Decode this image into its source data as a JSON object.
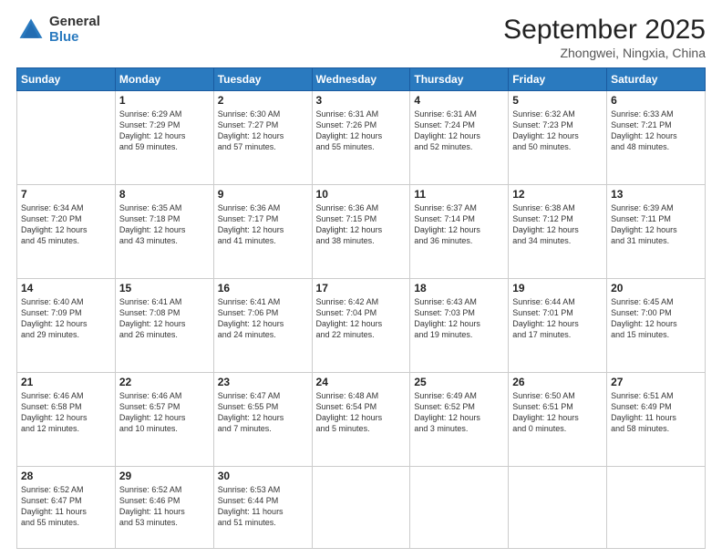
{
  "logo": {
    "general": "General",
    "blue": "Blue"
  },
  "title": {
    "month": "September 2025",
    "location": "Zhongwei, Ningxia, China"
  },
  "weekdays": [
    "Sunday",
    "Monday",
    "Tuesday",
    "Wednesday",
    "Thursday",
    "Friday",
    "Saturday"
  ],
  "weeks": [
    [
      {
        "day": "",
        "info": ""
      },
      {
        "day": "1",
        "info": "Sunrise: 6:29 AM\nSunset: 7:29 PM\nDaylight: 12 hours\nand 59 minutes."
      },
      {
        "day": "2",
        "info": "Sunrise: 6:30 AM\nSunset: 7:27 PM\nDaylight: 12 hours\nand 57 minutes."
      },
      {
        "day": "3",
        "info": "Sunrise: 6:31 AM\nSunset: 7:26 PM\nDaylight: 12 hours\nand 55 minutes."
      },
      {
        "day": "4",
        "info": "Sunrise: 6:31 AM\nSunset: 7:24 PM\nDaylight: 12 hours\nand 52 minutes."
      },
      {
        "day": "5",
        "info": "Sunrise: 6:32 AM\nSunset: 7:23 PM\nDaylight: 12 hours\nand 50 minutes."
      },
      {
        "day": "6",
        "info": "Sunrise: 6:33 AM\nSunset: 7:21 PM\nDaylight: 12 hours\nand 48 minutes."
      }
    ],
    [
      {
        "day": "7",
        "info": "Sunrise: 6:34 AM\nSunset: 7:20 PM\nDaylight: 12 hours\nand 45 minutes."
      },
      {
        "day": "8",
        "info": "Sunrise: 6:35 AM\nSunset: 7:18 PM\nDaylight: 12 hours\nand 43 minutes."
      },
      {
        "day": "9",
        "info": "Sunrise: 6:36 AM\nSunset: 7:17 PM\nDaylight: 12 hours\nand 41 minutes."
      },
      {
        "day": "10",
        "info": "Sunrise: 6:36 AM\nSunset: 7:15 PM\nDaylight: 12 hours\nand 38 minutes."
      },
      {
        "day": "11",
        "info": "Sunrise: 6:37 AM\nSunset: 7:14 PM\nDaylight: 12 hours\nand 36 minutes."
      },
      {
        "day": "12",
        "info": "Sunrise: 6:38 AM\nSunset: 7:12 PM\nDaylight: 12 hours\nand 34 minutes."
      },
      {
        "day": "13",
        "info": "Sunrise: 6:39 AM\nSunset: 7:11 PM\nDaylight: 12 hours\nand 31 minutes."
      }
    ],
    [
      {
        "day": "14",
        "info": "Sunrise: 6:40 AM\nSunset: 7:09 PM\nDaylight: 12 hours\nand 29 minutes."
      },
      {
        "day": "15",
        "info": "Sunrise: 6:41 AM\nSunset: 7:08 PM\nDaylight: 12 hours\nand 26 minutes."
      },
      {
        "day": "16",
        "info": "Sunrise: 6:41 AM\nSunset: 7:06 PM\nDaylight: 12 hours\nand 24 minutes."
      },
      {
        "day": "17",
        "info": "Sunrise: 6:42 AM\nSunset: 7:04 PM\nDaylight: 12 hours\nand 22 minutes."
      },
      {
        "day": "18",
        "info": "Sunrise: 6:43 AM\nSunset: 7:03 PM\nDaylight: 12 hours\nand 19 minutes."
      },
      {
        "day": "19",
        "info": "Sunrise: 6:44 AM\nSunset: 7:01 PM\nDaylight: 12 hours\nand 17 minutes."
      },
      {
        "day": "20",
        "info": "Sunrise: 6:45 AM\nSunset: 7:00 PM\nDaylight: 12 hours\nand 15 minutes."
      }
    ],
    [
      {
        "day": "21",
        "info": "Sunrise: 6:46 AM\nSunset: 6:58 PM\nDaylight: 12 hours\nand 12 minutes."
      },
      {
        "day": "22",
        "info": "Sunrise: 6:46 AM\nSunset: 6:57 PM\nDaylight: 12 hours\nand 10 minutes."
      },
      {
        "day": "23",
        "info": "Sunrise: 6:47 AM\nSunset: 6:55 PM\nDaylight: 12 hours\nand 7 minutes."
      },
      {
        "day": "24",
        "info": "Sunrise: 6:48 AM\nSunset: 6:54 PM\nDaylight: 12 hours\nand 5 minutes."
      },
      {
        "day": "25",
        "info": "Sunrise: 6:49 AM\nSunset: 6:52 PM\nDaylight: 12 hours\nand 3 minutes."
      },
      {
        "day": "26",
        "info": "Sunrise: 6:50 AM\nSunset: 6:51 PM\nDaylight: 12 hours\nand 0 minutes."
      },
      {
        "day": "27",
        "info": "Sunrise: 6:51 AM\nSunset: 6:49 PM\nDaylight: 11 hours\nand 58 minutes."
      }
    ],
    [
      {
        "day": "28",
        "info": "Sunrise: 6:52 AM\nSunset: 6:47 PM\nDaylight: 11 hours\nand 55 minutes."
      },
      {
        "day": "29",
        "info": "Sunrise: 6:52 AM\nSunset: 6:46 PM\nDaylight: 11 hours\nand 53 minutes."
      },
      {
        "day": "30",
        "info": "Sunrise: 6:53 AM\nSunset: 6:44 PM\nDaylight: 11 hours\nand 51 minutes."
      },
      {
        "day": "",
        "info": ""
      },
      {
        "day": "",
        "info": ""
      },
      {
        "day": "",
        "info": ""
      },
      {
        "day": "",
        "info": ""
      }
    ]
  ]
}
